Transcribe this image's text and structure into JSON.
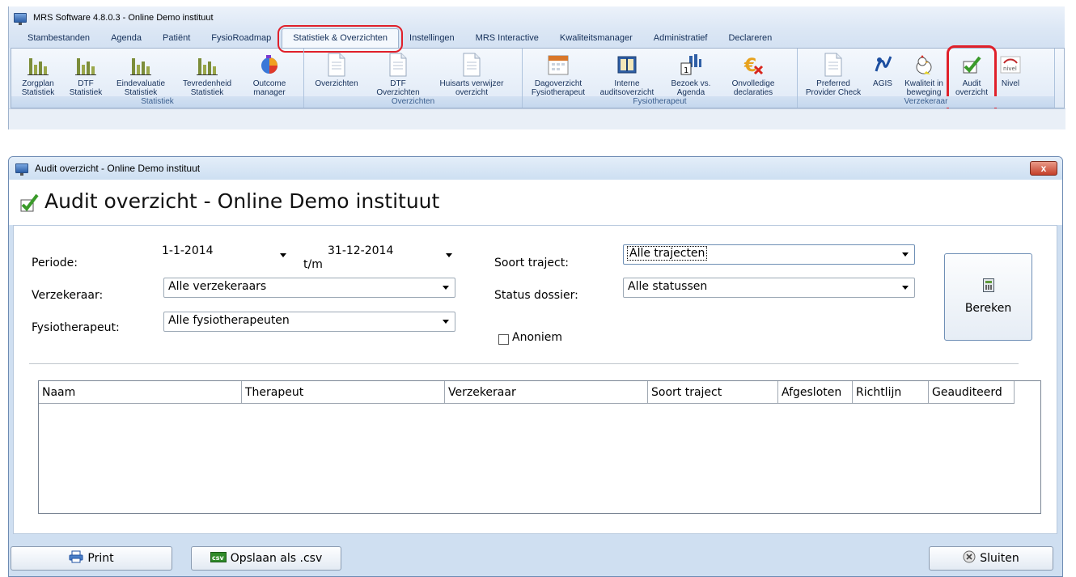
{
  "app": {
    "title": "MRS Software 4.8.0.3 - Online Demo instituut",
    "tabs": [
      {
        "label": "Stambestanden"
      },
      {
        "label": "Agenda"
      },
      {
        "label": "Patiënt"
      },
      {
        "label": "FysioRoadmap"
      },
      {
        "label": "Statistiek & Overzichten",
        "active": true
      },
      {
        "label": "Instellingen"
      },
      {
        "label": "MRS Interactive"
      },
      {
        "label": "Kwaliteitsmanager"
      },
      {
        "label": "Administratief"
      },
      {
        "label": "Declareren"
      }
    ],
    "ribbon": {
      "statistiek": {
        "label": "Statistiek",
        "buttons": [
          {
            "line1": "Zorgplan",
            "line2": "Statistiek",
            "icon": "bar-chart-icon"
          },
          {
            "line1": "DTF",
            "line2": "Statistiek",
            "icon": "bar-chart-icon"
          },
          {
            "line1": "Eindevaluatie",
            "line2": "Statistiek",
            "icon": "bar-chart-icon"
          },
          {
            "line1": "Tevredenheid",
            "line2": "Statistiek",
            "icon": "bar-chart-icon"
          },
          {
            "line1": "Outcome",
            "line2": "manager",
            "icon": "outcome-icon"
          }
        ]
      },
      "overzichten": {
        "label": "Overzichten",
        "buttons": [
          {
            "line1": "Overzichten",
            "line2": "",
            "icon": "document-icon"
          },
          {
            "line1": "DTF",
            "line2": "Overzichten",
            "icon": "document-icon"
          },
          {
            "line1": "Huisarts verwijzer",
            "line2": "overzicht",
            "icon": "document-icon"
          }
        ]
      },
      "fysiotherapeut": {
        "label": "Fysiotherapeut",
        "buttons": [
          {
            "line1": "Dagoverzicht",
            "line2": "Fysiotherapeut",
            "icon": "calendar-icon"
          },
          {
            "line1": "Interne",
            "line2": "auditsoverzicht",
            "icon": "book-icon"
          },
          {
            "line1": "Bezoek vs.",
            "line2": "Agenda",
            "icon": "agenda-chart-icon"
          },
          {
            "line1": "Onvolledige",
            "line2": "declaraties",
            "icon": "euro-cross-icon"
          }
        ]
      },
      "verzekeraar": {
        "label": "Verzekeraar",
        "buttons": [
          {
            "line1": "Preferred",
            "line2": "Provider Check",
            "icon": "document-icon"
          },
          {
            "line1": "AGIS",
            "line2": "",
            "icon": "agis-icon"
          },
          {
            "line1": "Kwaliteit in",
            "line2": "beweging",
            "icon": "chicken-icon"
          },
          {
            "line1": "Audit",
            "line2": "overzicht",
            "icon": "checkmark-icon"
          },
          {
            "line1": "Nivel",
            "line2": "",
            "icon": "nivel-icon"
          }
        ]
      }
    }
  },
  "dialog": {
    "window_title": "Audit overzicht - Online Demo instituut",
    "heading": "Audit overzicht - Online Demo instituut",
    "close_label": "x",
    "form": {
      "periode_label": "Periode:",
      "date_from": "1-1-2014",
      "tm_label": "t/m",
      "date_to": "31-12-2014",
      "verzekeraar_label": "Verzekeraar:",
      "verzekeraar_value": "Alle verzekeraars",
      "fysio_label": "Fysiotherapeut:",
      "fysio_value": "Alle fysiotherapeuten",
      "soort_label": "Soort traject:",
      "soort_value": "Alle trajecten",
      "status_label": "Status dossier:",
      "status_value": "Alle statussen",
      "anoniem_label": "Anoniem",
      "anoniem_checked": false,
      "bereken_label": "Bereken"
    },
    "grid": {
      "columns": [
        "Naam",
        "Therapeut",
        "Verzekeraar",
        "Soort traject",
        "Afgesloten",
        "Richtlijn",
        "Geauditeerd"
      ],
      "rows": []
    },
    "footer": {
      "print_label": "Print",
      "csv_label": "Opslaan als .csv",
      "csv_badge": "csv",
      "close_label": "Sluiten"
    }
  },
  "colors": {
    "highlight": "#e0202a",
    "ribbon_bg": "#dbe7f5",
    "dialog_frame": "#cfdff1"
  }
}
